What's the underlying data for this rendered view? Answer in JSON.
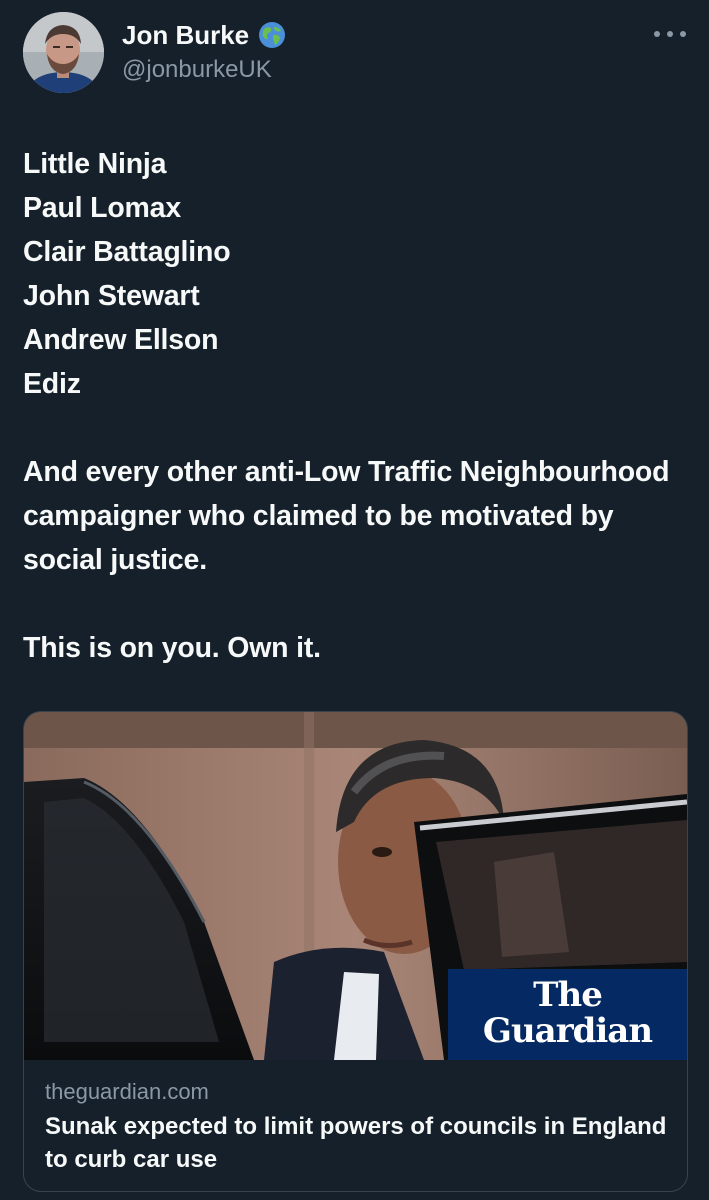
{
  "author": {
    "display_name": "Jon Burke",
    "handle": "@jonburkeUK",
    "badge_icon": "globe-icon"
  },
  "tweet": {
    "names": [
      "Little Ninja",
      "Paul Lomax",
      "Clair Battaglino",
      "John Stewart",
      "Andrew Ellson",
      "Ediz"
    ],
    "paragraph_1": "And every other anti-Low Traffic Neighbourhood campaigner who claimed to be motivated by social justice.",
    "paragraph_2": "This is on you. Own it."
  },
  "card": {
    "logo_line_1": "The",
    "logo_line_2": "Guardian",
    "domain": "theguardian.com",
    "title": "Sunak expected to limit powers of councils in England to curb car use"
  },
  "colors": {
    "background": "#15202b",
    "primary_text": "#f7f9f9",
    "secondary_text": "#8b98a5",
    "border": "#38444d",
    "guardian_blue": "#052962"
  }
}
